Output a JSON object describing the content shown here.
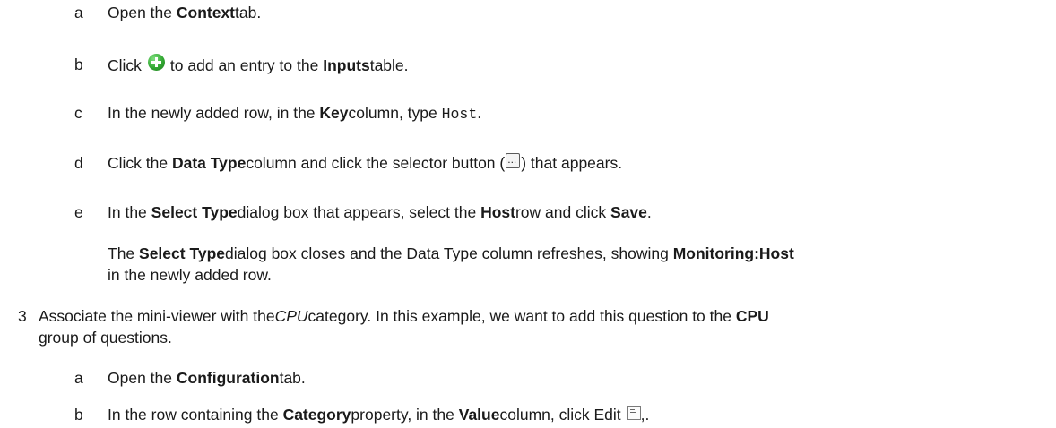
{
  "steps": {
    "a1": {
      "marker": "a",
      "t1": "Open the ",
      "b1": "Context",
      "t2": " tab."
    },
    "b1": {
      "marker": "b",
      "t1": "Click ",
      "icon": "plus-add-icon",
      "t2": " to add an entry to the ",
      "b1": "Inputs",
      "t3": " table."
    },
    "c1": {
      "marker": "c",
      "t1": "In the newly added row, in the ",
      "b1": "Key",
      "t2": " column, type ",
      "code": "Host",
      "t3": "."
    },
    "d1": {
      "marker": "d",
      "t1": "Click the ",
      "b1": "Data Type",
      "t2": " column and click the selector button (",
      "icon": "ellipsis-selector-icon",
      "t3": ") that appears."
    },
    "e1": {
      "marker": "e",
      "t1": "In the ",
      "b1": "Select Type",
      "t2": " dialog box that appears, select the ",
      "b2": "Host",
      "t3": " row and click ",
      "b3": "Save",
      "t4": "."
    },
    "note": {
      "line1": {
        "t1": "The ",
        "b1": "Select Type",
        "t2": " dialog box closes and the Data Type column refreshes, showing ",
        "b2": "Monitoring:Host"
      },
      "line2": {
        "t1": "in the newly added row."
      }
    },
    "step3": {
      "marker": "3",
      "line1": {
        "t1": "Associate the mini-viewer with the ",
        "i1": "CPU",
        "t2": " category. In this example, we want to add this question to the ",
        "b1": "CPU"
      },
      "line2": {
        "t1": "group of questions."
      }
    },
    "a3": {
      "marker": "a",
      "t1": "Open the ",
      "b1": "Configuration",
      "t2": " tab."
    },
    "b3": {
      "marker": "b",
      "t1": "In the row containing the ",
      "b1": "Category",
      "t2": " property, in the ",
      "b2": "Value",
      "t3": " column, click Edit ",
      "icon": "edit-list-icon",
      "t4": ",."
    }
  }
}
